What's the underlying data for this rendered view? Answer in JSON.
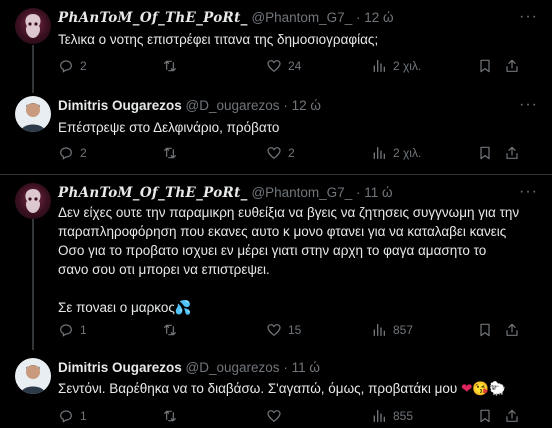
{
  "tweets": [
    {
      "name": "PhAnToM_Of_ThE_PoRt_",
      "handle": "@Phantom_G7_",
      "time": "12 ώ",
      "lines": [
        "Τελικα ο νοτης επιστρέφει τιτανα της δημοσιογραφίας;"
      ],
      "replies": "2",
      "retweets": "",
      "likes": "24",
      "views": "2 χιλ."
    },
    {
      "name": "Dimitris Ougarezos",
      "handle": "@D_ougarezos",
      "time": "12 ώ",
      "lines": [
        "Επέστρεψε στο Δελφινάριο, πρόβατο"
      ],
      "replies": "2",
      "retweets": "",
      "likes": "2",
      "views": "2 χιλ."
    },
    {
      "name": "PhAnToM_Of_ThE_PoRt_",
      "handle": "@Phantom_G7_",
      "time": "11 ώ",
      "lines": [
        "Δεν είχες ουτε την παραμικρη ευθείξια να βγεις να ζητησεις συγγνωμη για την",
        "παραπληροφόρηση που εκανες αυτο κ μονο φτανει για να καταλαβει κανεις",
        "Οσο για το προβατο ισχυει εν μέρει γιατι στην αρχη το φαγα αμασητο το",
        "σανο σου οτι μπορει να επιστρεψει.",
        "",
        "Σε πονaει ο μαρκος"
      ],
      "replies": "1",
      "retweets": "",
      "likes": "15",
      "views": "857"
    },
    {
      "name": "Dimitris Ougarezos",
      "handle": "@D_ougarezos",
      "time": "11 ώ",
      "lines": [
        "Σεντόνι. Βαρέθηκα να το διαβάσω. Σ'αγαπώ, όμως, προβατάκι μου"
      ],
      "replies": "1",
      "retweets": "",
      "likes": "",
      "views": "855"
    }
  ],
  "separator": "·",
  "more_glyph": "···",
  "emoji": {
    "sweat": "💦",
    "heart": "❤",
    "kiss": "😘",
    "sheep": "🐑"
  }
}
